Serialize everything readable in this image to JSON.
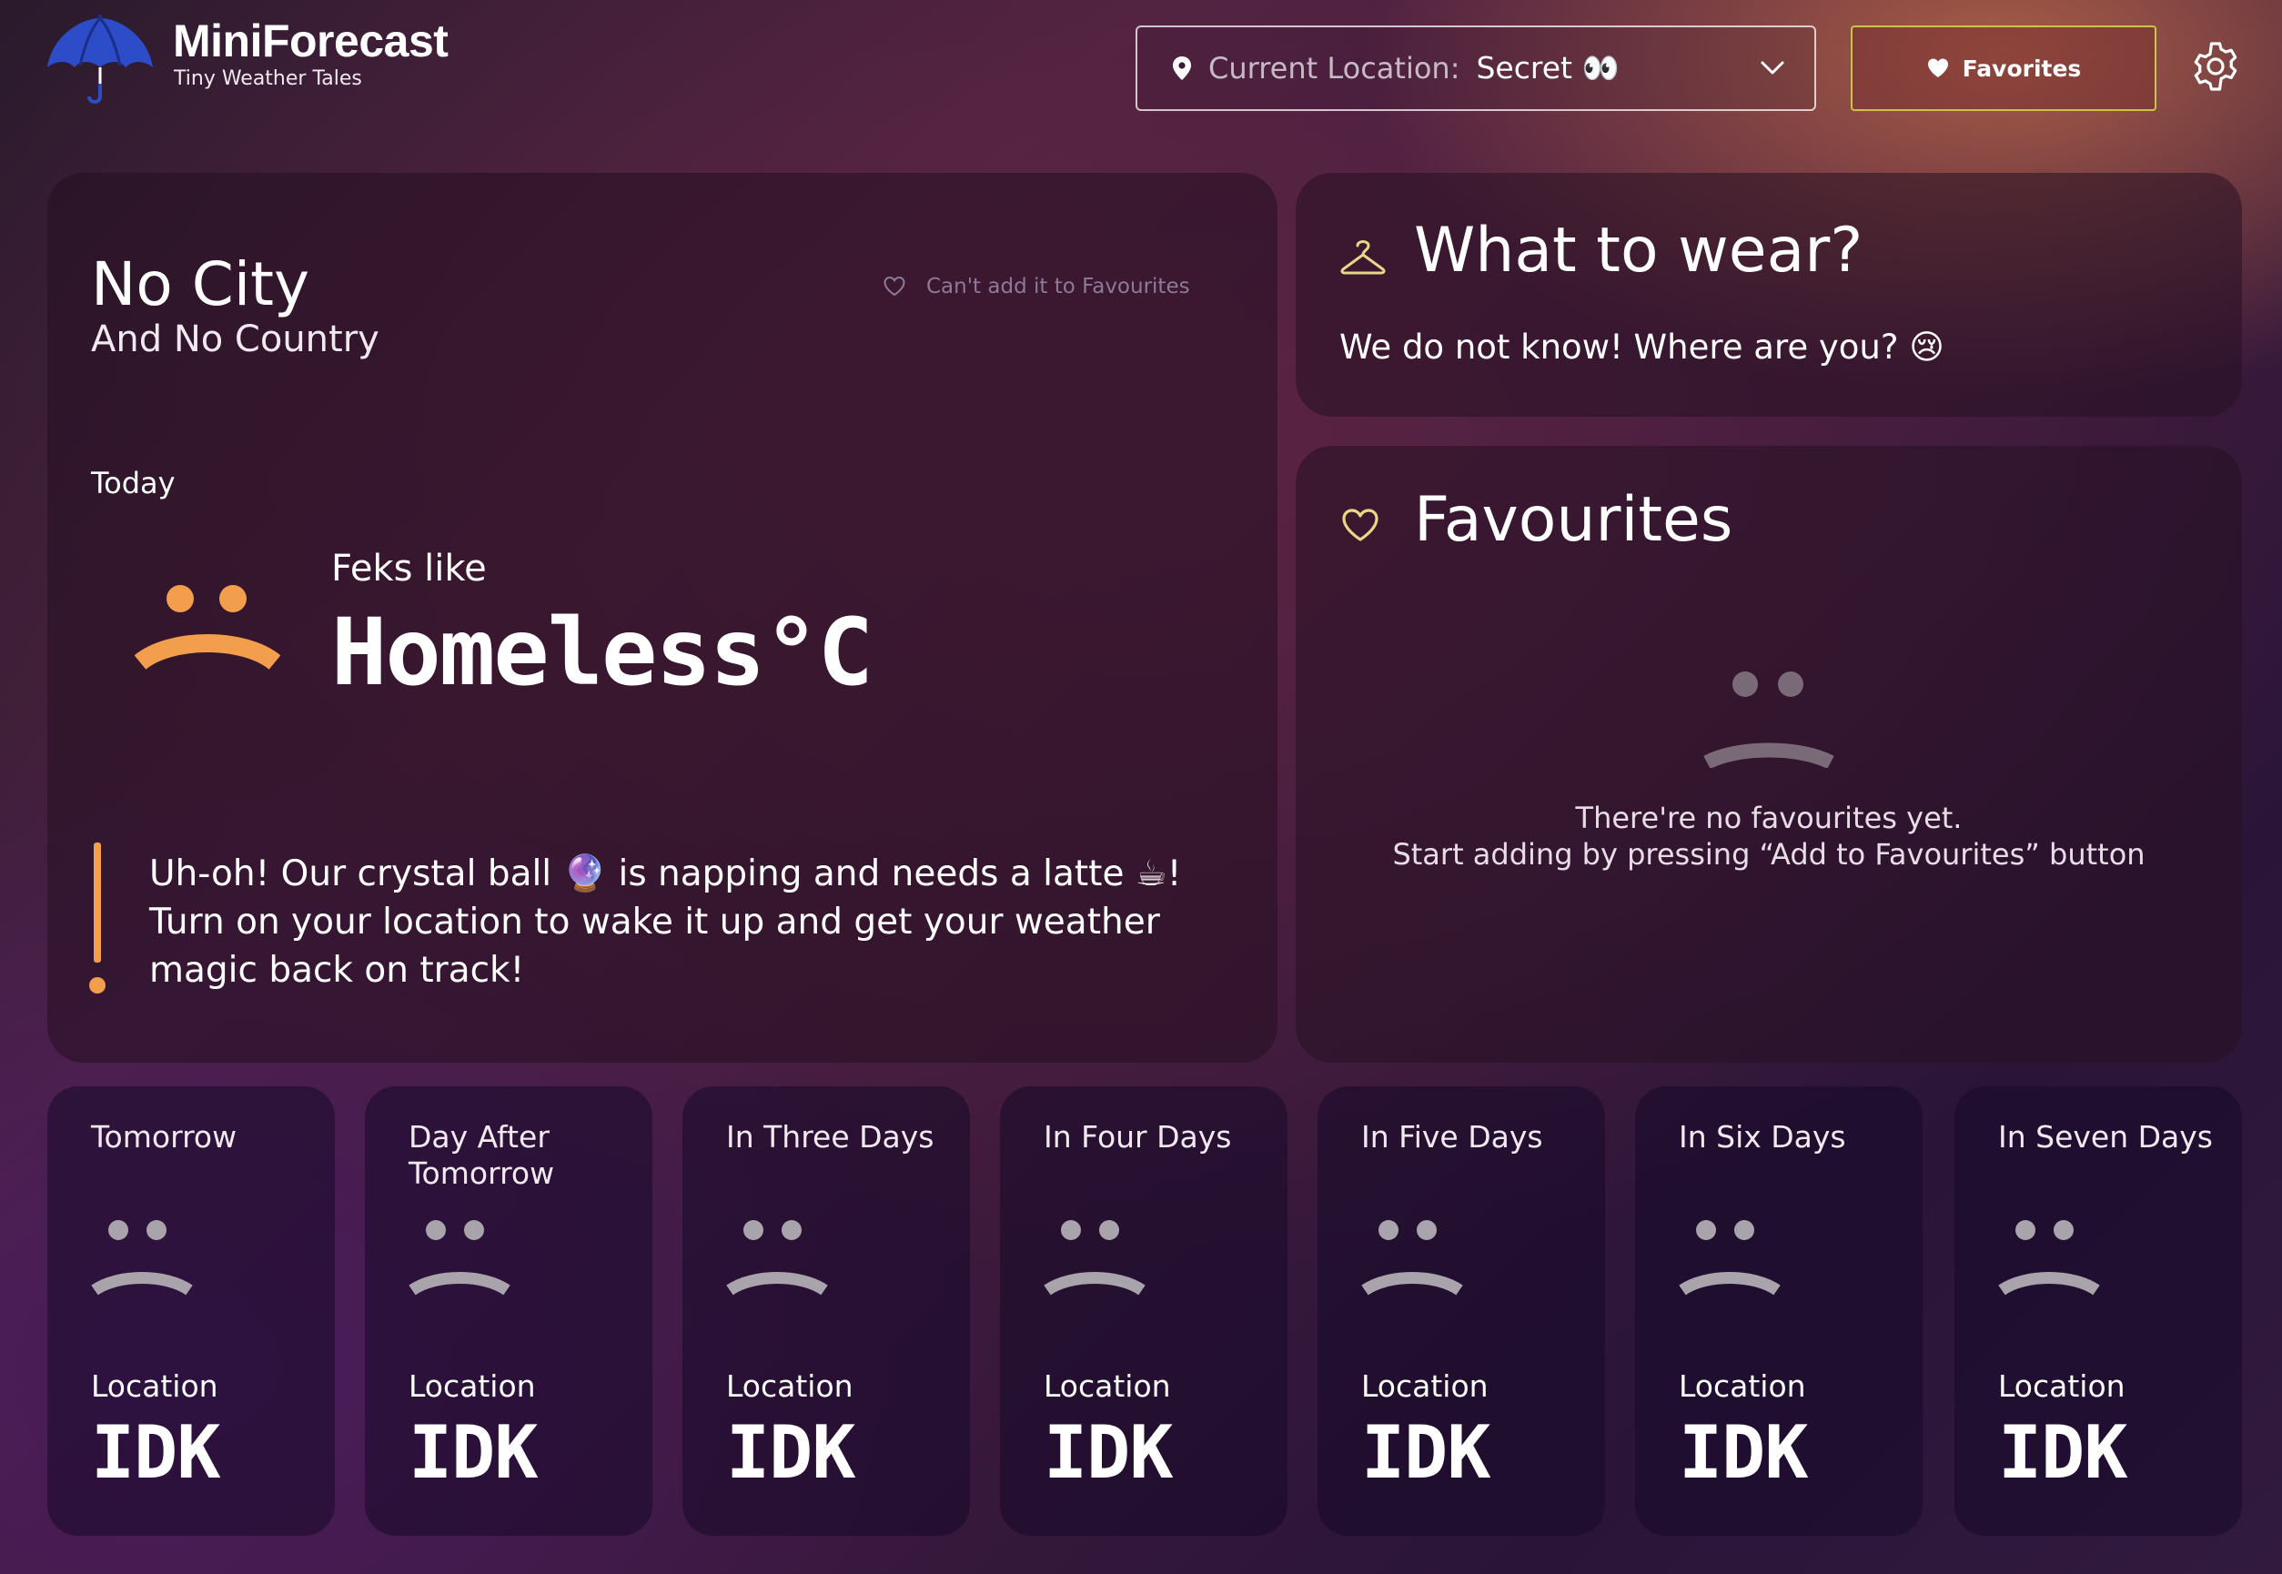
{
  "header": {
    "app_title": "MiniForecast",
    "app_subtitle": "Tiny Weather Tales",
    "logo_icon": "umbrella-icon",
    "location": {
      "label": "Current Location:",
      "value": "Secret 👀"
    },
    "favorites_button": "Favorites",
    "settings_icon": "gear-icon"
  },
  "current": {
    "city": "No City",
    "country": "And No Country",
    "add_favourite_label": "Can't add it to Favourites",
    "today_label": "Today",
    "feels_label": "Feks like",
    "temperature": "Homeless°C",
    "alert_message": "Uh-oh! Our crystal ball 🔮 is napping and needs a latte ☕! Turn on your location to wake it up and get your weather magic back on track!"
  },
  "wear": {
    "title": "What to wear?",
    "message": "We do not know! Where are you? 😢"
  },
  "favourites": {
    "title": "Favourites",
    "empty_line1": "There're no favourites yet.",
    "empty_line2": "Start adding by pressing “Add to Favourites” button"
  },
  "forecast": [
    {
      "day": "Tomorrow",
      "location_label": "Location",
      "value": "IDK"
    },
    {
      "day": "Day After Tomorrow",
      "location_label": "Location",
      "value": "IDK"
    },
    {
      "day": "In Three Days",
      "location_label": "Location",
      "value": "IDK"
    },
    {
      "day": "In Four Days",
      "location_label": "Location",
      "value": "IDK"
    },
    {
      "day": "In Five Days",
      "location_label": "Location",
      "value": "IDK"
    },
    {
      "day": "In Six Days",
      "location_label": "Location",
      "value": "IDK"
    },
    {
      "day": "In Seven Days",
      "location_label": "Location",
      "value": "IDK"
    }
  ],
  "colors": {
    "accent_orange": "#f29e4c",
    "favorite_border": "#c9c44a",
    "muted_face": "#a9a3ab",
    "hanger_yellow": "#e6d889"
  }
}
